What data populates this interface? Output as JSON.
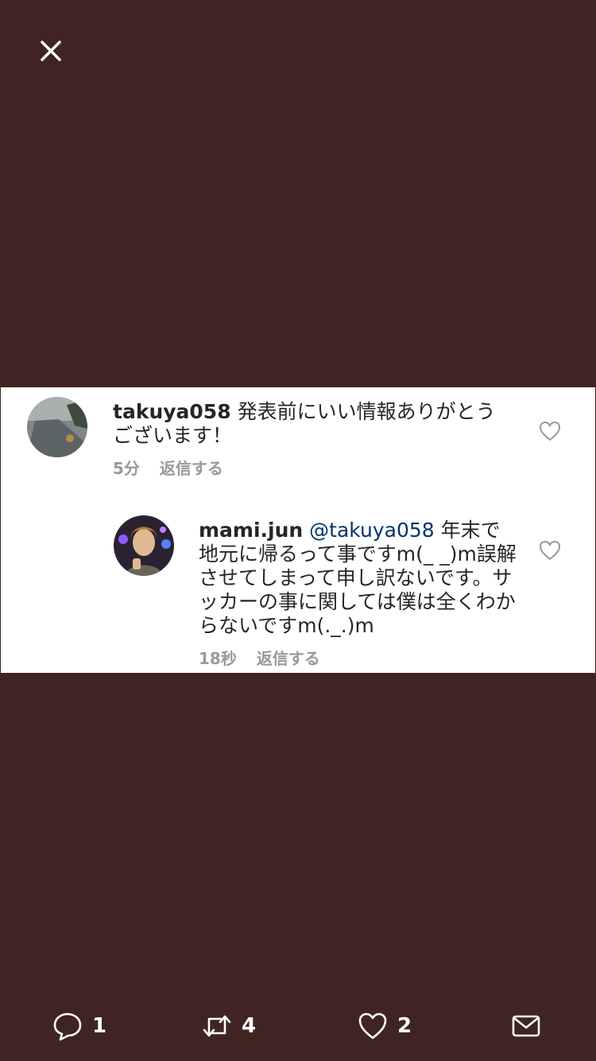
{
  "colors": {
    "background": "#402422",
    "card": "#ffffff",
    "mention": "#003569",
    "meta": "#999999"
  },
  "close": {
    "icon": "close-icon"
  },
  "comments": [
    {
      "username": "takuya058",
      "text": "発表前にいい情報ありがとうございます！",
      "time": "5分",
      "reply_label": "返信する"
    },
    {
      "username": "mami.jun",
      "mention": "@takuya058",
      "text": "年末で地元に帰るって事ですm(_ _)m誤解させてしまって申し訳ないです。サッカーの事に関しては僕は全くわからないですm(._.)m",
      "time": "18秒",
      "reply_label": "返信する"
    }
  ],
  "actions": {
    "reply_count": "1",
    "retweet_count": "4",
    "like_count": "2"
  }
}
